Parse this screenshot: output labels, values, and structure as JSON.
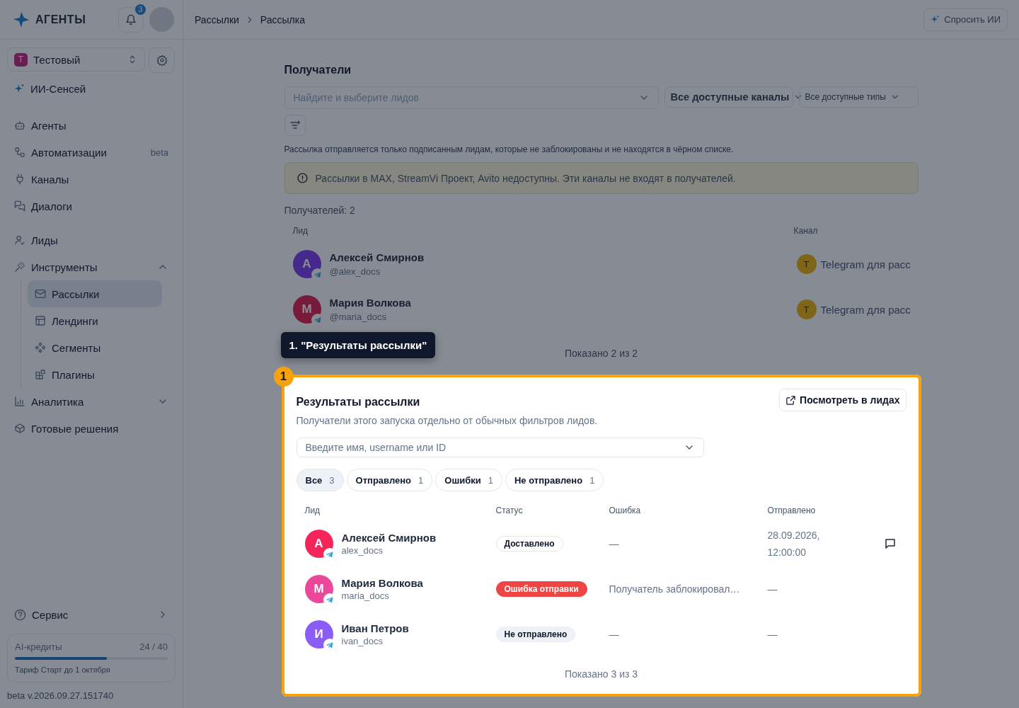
{
  "app": {
    "logo": "АГЕНТЫ",
    "notifications": "3"
  },
  "sidebar": {
    "workspace": {
      "letter": "Т",
      "name": "Тестовый"
    },
    "ai_item": "ИИ-Сенсей",
    "items": [
      {
        "kind": "link",
        "label": "Агенты"
      },
      {
        "kind": "link",
        "label": "Автоматизации",
        "badge": "beta"
      },
      {
        "kind": "link",
        "label": "Каналы"
      },
      {
        "kind": "link",
        "label": "Диалоги"
      },
      {
        "kind": "gap"
      },
      {
        "kind": "link",
        "label": "Лиды"
      },
      {
        "kind": "group",
        "label": "Инструменты",
        "expanded": true,
        "children": [
          {
            "label": "Рассылки",
            "selected": true
          },
          {
            "label": "Лендинги",
            "selected": false
          },
          {
            "label": "Сегменты",
            "selected": false
          },
          {
            "label": "Плагины",
            "selected": false
          }
        ]
      },
      {
        "kind": "group",
        "label": "Аналитика",
        "expanded": false
      },
      {
        "kind": "link",
        "label": "Готовые решения"
      }
    ],
    "service": "Сервис",
    "credits": {
      "label": "AI-кредиты",
      "value": "24 / 40",
      "level": 0.6,
      "note": "Тариф Старт до 1 октября"
    },
    "version": "beta v.2026.09.27.151740"
  },
  "header": {
    "breadcrumbs": [
      "Рассылки",
      "Рассылка"
    ],
    "ask_ai": "Спросить ИИ"
  },
  "recipients": {
    "title": "Получатели",
    "lead_search": {
      "placeholder": "Найдите и выберите лидов"
    },
    "channel_filter": "Все доступные каналы",
    "type_filter": "Все доступные типы",
    "note": "Рассылка отправляется только подписанным лидам, которые не заблокированы и не находятся в чёрном списке.",
    "warning": "Рассылки в MAX, StreamVi Проект, Avito недоступны. Эти каналы не входят в получателей.",
    "count": "Получателей: 2",
    "columns": [
      "Лид",
      "Канал"
    ],
    "rows": [
      {
        "letter": "А",
        "name": "Алексей Смирнов",
        "username": "@alex_docs",
        "channel_letter": "Т",
        "channel": "Telegram для расс"
      },
      {
        "letter": "М",
        "name": "Мария Волкова",
        "username": "@maria_docs",
        "channel_letter": "Т",
        "channel": "Telegram для расс"
      }
    ],
    "footer": "Показано 2 из 2"
  },
  "tour": {
    "step": "1",
    "tooltip": "1. \"Результаты рассылки\""
  },
  "results": {
    "title": "Результаты рассылки",
    "subtitle": "Получатели этого запуска отдельно от обычных фильтров лидов.",
    "view_button": "Посмотреть в лидах",
    "search": {
      "placeholder": "Введите имя, username или ID"
    },
    "tabs": [
      {
        "label": "Все",
        "count": "3",
        "selected": true
      },
      {
        "label": "Отправлено",
        "count": "1",
        "selected": false
      },
      {
        "label": "Ошибки",
        "count": "1",
        "selected": false
      },
      {
        "label": "Не отправлено",
        "count": "1",
        "selected": false
      }
    ],
    "columns": [
      "Лид",
      "Статус",
      "Ошибка",
      "Отправлено"
    ],
    "rows": [
      {
        "letter": "А",
        "color": "#f5245a",
        "name": "Алексей Смирнов",
        "username": "alex_docs",
        "status": {
          "kind": "delivered",
          "label": "Доставлено"
        },
        "error": "—",
        "sent": "28.09.2026, 12:00:00",
        "chat": true
      },
      {
        "letter": "М",
        "color": "#ec4899",
        "name": "Мария Волкова",
        "username": "maria_docs",
        "status": {
          "kind": "error",
          "label": "Ошибка отправки"
        },
        "error": "Получатель заблокировал…",
        "sent": "—",
        "chat": false
      },
      {
        "letter": "И",
        "color": "#8b5cf6",
        "name": "Иван Петров",
        "username": "ivan_docs",
        "status": {
          "kind": "not_sent",
          "label": "Не отправлено"
        },
        "error": "—",
        "sent": "—",
        "chat": false
      }
    ],
    "footer": "Показано 3 из 3"
  }
}
